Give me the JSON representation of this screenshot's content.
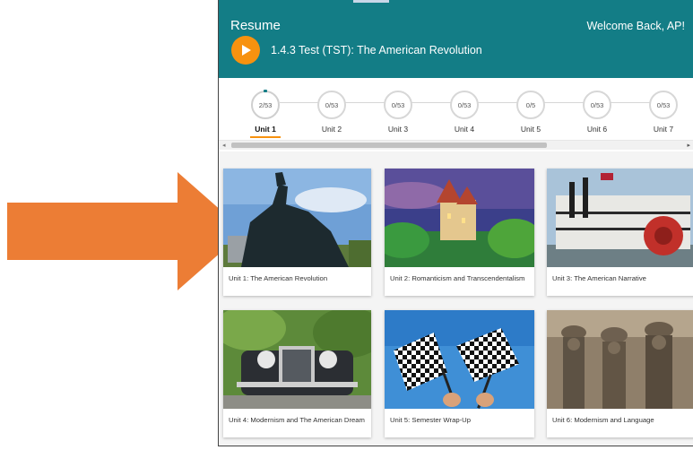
{
  "header": {
    "resume_label": "Resume",
    "welcome": "Welcome Back, AP!",
    "course_title": "1.4.3 Test (TST): The American Revolution"
  },
  "units": [
    {
      "progress": "2/53",
      "label": "Unit 1",
      "active": true
    },
    {
      "progress": "0/53",
      "label": "Unit 2"
    },
    {
      "progress": "0/53",
      "label": "Unit 3"
    },
    {
      "progress": "0/53",
      "label": "Unit 4"
    },
    {
      "progress": "0/5",
      "label": "Unit 5"
    },
    {
      "progress": "0/53",
      "label": "Unit 6"
    },
    {
      "progress": "0/53",
      "label": "Unit 7"
    }
  ],
  "cards": [
    {
      "title": "Unit 1: The American Revolution"
    },
    {
      "title": "Unit 2: Romanticism and Transcendentalism"
    },
    {
      "title": "Unit 3: The American Narrative"
    },
    {
      "title": "Unit 4: Modernism and The American Dream"
    },
    {
      "title": "Unit 5: Semester Wrap-Up"
    },
    {
      "title": "Unit 6: Modernism and Language"
    }
  ],
  "colors": {
    "header_bg": "#137d86",
    "accent_orange": "#f7920f",
    "arrow": "#ec7d35"
  }
}
